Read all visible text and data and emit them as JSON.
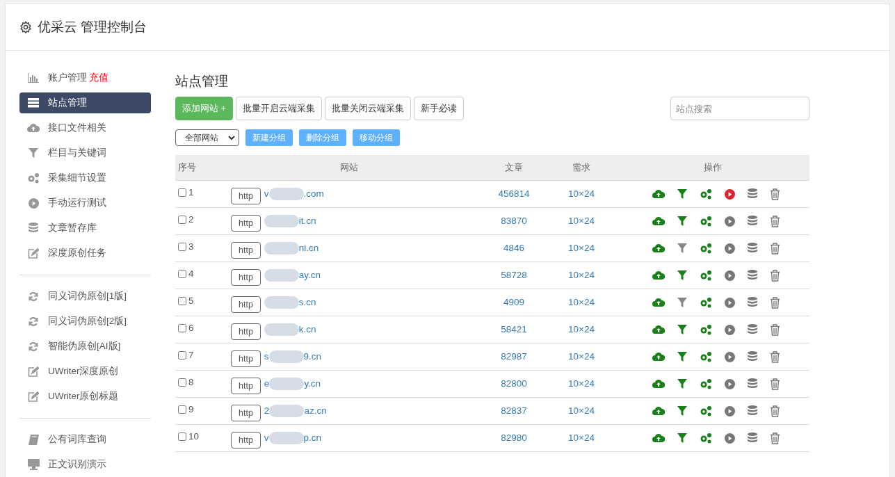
{
  "header": {
    "title": "优采云 管理控制台"
  },
  "sidebar": {
    "groups": [
      [
        {
          "label": "账户管理",
          "badge": "充值",
          "kind": "chart",
          "selected": false
        },
        {
          "label": "站点管理",
          "kind": "server",
          "selected": true
        },
        {
          "label": "接口文件相关",
          "kind": "cloud",
          "selected": false
        },
        {
          "label": "栏目与关键词",
          "kind": "filter",
          "selected": false
        },
        {
          "label": "采集细节设置",
          "kind": "gears",
          "selected": false
        },
        {
          "label": "手动运行测试",
          "kind": "play",
          "selected": false
        },
        {
          "label": "文章暂存库",
          "kind": "database",
          "selected": false
        },
        {
          "label": "深度原创任务",
          "kind": "edit",
          "selected": false
        }
      ],
      [
        {
          "label": "同义词伪原创[1版]",
          "kind": "refresh",
          "selected": false
        },
        {
          "label": "同义词伪原创[2版]",
          "kind": "refresh",
          "selected": false
        },
        {
          "label": "智能伪原创[AI版]",
          "kind": "refresh",
          "selected": false
        },
        {
          "label": "UWriter深度原创",
          "kind": "edit",
          "selected": false
        },
        {
          "label": "UWriter原创标题",
          "kind": "edit",
          "selected": false
        }
      ],
      [
        {
          "label": "公有词库查询",
          "kind": "book",
          "selected": false
        },
        {
          "label": "正文识别演示",
          "kind": "monitor",
          "selected": false
        }
      ]
    ]
  },
  "main": {
    "title": "站点管理",
    "actions": [
      {
        "label": "添加网站 +",
        "kind": "primary"
      },
      {
        "label": "批量开启云端采集",
        "kind": "default"
      },
      {
        "label": "批量关闭云端采集",
        "kind": "default"
      },
      {
        "label": "新手必读",
        "kind": "default"
      }
    ],
    "search": {
      "placeholder": "站点搜索"
    },
    "group_select": {
      "value": "全部网站"
    },
    "group_buttons": [
      "新建分组",
      "删除分组",
      "移动分组"
    ],
    "table": {
      "columns": [
        "序号",
        "网站",
        "文章",
        "需求",
        "操作"
      ],
      "rows": [
        {
          "checked": false,
          "index": "1",
          "scheme": "http",
          "site_prefix": "v",
          "site_suffix": ".com",
          "articles": "456814",
          "demand": "10×24",
          "filter_on": true,
          "running": true
        },
        {
          "checked": false,
          "index": "2",
          "scheme": "http",
          "site_prefix": "",
          "site_suffix": "it.cn",
          "articles": "83870",
          "demand": "10×24",
          "filter_on": true,
          "running": false
        },
        {
          "checked": false,
          "index": "3",
          "scheme": "http",
          "site_prefix": "",
          "site_suffix": "ni.cn",
          "articles": "4846",
          "demand": "10×24",
          "filter_on": false,
          "running": false
        },
        {
          "checked": false,
          "index": "4",
          "scheme": "http",
          "site_prefix": "",
          "site_suffix": "ay.cn",
          "articles": "58728",
          "demand": "10×24",
          "filter_on": true,
          "running": false
        },
        {
          "checked": false,
          "index": "5",
          "scheme": "http",
          "site_prefix": "",
          "site_suffix": "s.cn",
          "articles": "4909",
          "demand": "10×24",
          "filter_on": false,
          "running": false
        },
        {
          "checked": false,
          "index": "6",
          "scheme": "http",
          "site_prefix": "",
          "site_suffix": "k.cn",
          "articles": "58421",
          "demand": "10×24",
          "filter_on": true,
          "running": false
        },
        {
          "checked": false,
          "index": "7",
          "scheme": "http",
          "site_prefix": "s",
          "site_suffix": "9.cn",
          "articles": "82987",
          "demand": "10×24",
          "filter_on": true,
          "running": false
        },
        {
          "checked": false,
          "index": "8",
          "scheme": "http",
          "site_prefix": "e",
          "site_suffix": "y.cn",
          "articles": "82800",
          "demand": "10×24",
          "filter_on": true,
          "running": false
        },
        {
          "checked": false,
          "index": "9",
          "scheme": "http",
          "site_prefix": "2",
          "site_suffix": "az.cn",
          "articles": "82837",
          "demand": "10×24",
          "filter_on": true,
          "running": false
        },
        {
          "checked": false,
          "index": "10",
          "scheme": "http",
          "site_prefix": "v",
          "site_suffix": "p.cn",
          "articles": "82980",
          "demand": "10×24",
          "filter_on": true,
          "running": false
        }
      ]
    }
  }
}
